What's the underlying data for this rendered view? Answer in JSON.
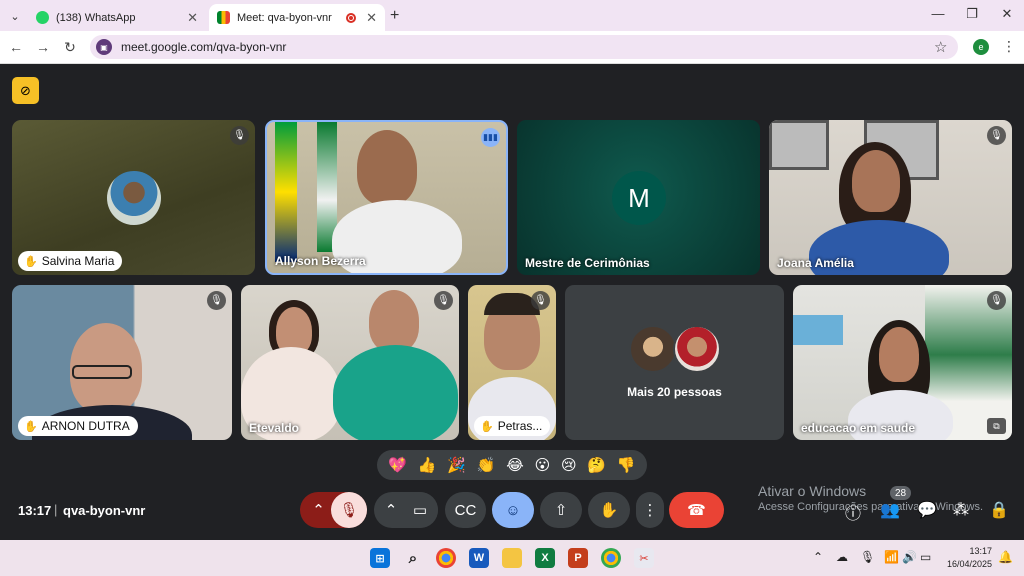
{
  "browser": {
    "tabs": [
      {
        "title": "(138) WhatsApp",
        "active": false
      },
      {
        "title": "Meet: qva-byon-vnr",
        "active": true
      }
    ],
    "url": "meet.google.com/qva-byon-vnr",
    "profile_initial": "e"
  },
  "meet": {
    "participants": [
      {
        "name": "Salvina Maria",
        "muted": true,
        "style": "pill"
      },
      {
        "name": "Allyson Bezerra",
        "muted": false,
        "speaking": true,
        "style": "label"
      },
      {
        "name": "Mestre de Cerimônias",
        "muted": false,
        "avatar_letter": "M",
        "style": "label"
      },
      {
        "name": "Joana Amélia",
        "muted": true,
        "style": "label"
      },
      {
        "name": "ARNON DUTRA",
        "muted": true,
        "style": "pill"
      },
      {
        "name": "Etevaldo",
        "muted": true,
        "style": "label"
      },
      {
        "name": "Petras...",
        "muted": true,
        "style": "pill"
      },
      {
        "name": "Mais 20 pessoas",
        "style": "label"
      },
      {
        "name": "educacao em saude",
        "muted": true,
        "style": "label"
      }
    ],
    "reactions": [
      "💖",
      "👍",
      "🎉",
      "👏",
      "😂",
      "😮",
      "😢",
      "🤔",
      "👎"
    ],
    "time": "13:17",
    "meeting_code": "qva-byon-vnr",
    "people_count": "28"
  },
  "windows": {
    "activation_title": "Ativar o Windows",
    "activation_sub": "Acesse Configurações para ativar o Windows.",
    "clock_time": "13:17",
    "clock_date": "16/04/2025"
  },
  "colors": {
    "end_call": "#ea4335",
    "active_control": "#8ab4f8",
    "muted_mic": "#f9dedc"
  }
}
